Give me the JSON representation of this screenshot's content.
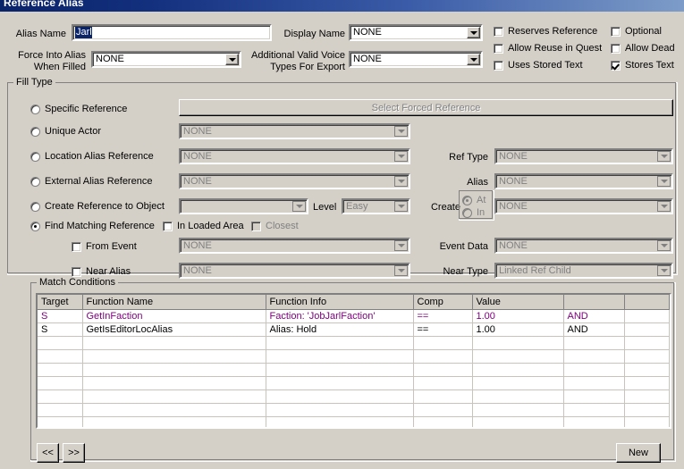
{
  "window": {
    "title": "Reference Alias"
  },
  "form": {
    "alias_name_label": "Alias Name",
    "alias_name_value": "Jarl",
    "display_name_label": "Display Name",
    "display_name_value": "NONE",
    "force_into_alias_label_l1": "Force Into Alias",
    "force_into_alias_label_l2": "When Filled",
    "force_into_alias_value": "NONE",
    "additional_voice_label_l1": "Additional Valid Voice",
    "additional_voice_label_l2": "Types For Export",
    "additional_voice_value": "NONE"
  },
  "flags": [
    {
      "label": "Reserves Reference",
      "checked": false
    },
    {
      "label": "Optional",
      "checked": false
    },
    {
      "label": "Allow Reuse in Quest",
      "checked": false
    },
    {
      "label": "Allow Dead",
      "checked": false
    },
    {
      "label": "Uses Stored Text",
      "checked": false
    },
    {
      "label": "Stores Text",
      "checked": true
    }
  ],
  "fill_type": {
    "group_label": "Fill Type",
    "options": [
      {
        "label": "Specific Reference",
        "selected": false
      },
      {
        "label": "Unique Actor",
        "selected": false
      },
      {
        "label": "Location Alias Reference",
        "selected": false
      },
      {
        "label": "External Alias Reference",
        "selected": false
      },
      {
        "label": "Create Reference to Object",
        "selected": false
      },
      {
        "label": "Find Matching Reference",
        "selected": true
      }
    ],
    "forced_reference_button": "Select Forced Reference",
    "unique_actor_value": "NONE",
    "location_alias_value": "NONE",
    "external_alias_value": "NONE",
    "create_ref_object_value": "",
    "level_label": "Level",
    "level_value": "Easy",
    "in_loaded_area_label": "In Loaded Area",
    "in_loaded_area_checked": false,
    "closest_label": "Closest",
    "closest_checked": false,
    "from_event_label": "From Event",
    "from_event_checked": false,
    "from_event_value": "NONE",
    "near_alias_label": "Near Alias",
    "near_alias_checked": false,
    "near_alias_value": "NONE",
    "ref_type_label": "Ref Type",
    "ref_type_value": "NONE",
    "alias_label": "Alias",
    "alias_value": "NONE",
    "create_label": "Create",
    "create_at_label": "At",
    "create_in_label": "In",
    "create_at_selected": true,
    "create_value": "NONE",
    "event_data_label": "Event Data",
    "event_data_value": "NONE",
    "near_type_label": "Near Type",
    "near_type_value": "Linked Ref Child"
  },
  "match_conditions": {
    "group_label": "Match Conditions",
    "columns": [
      "Target",
      "Function Name",
      "Function Info",
      "Comp",
      "Value",
      "",
      ""
    ],
    "rows": [
      {
        "cells": [
          "S",
          "GetInFaction",
          "Faction: 'JobJarlFaction'",
          "==",
          "1.00",
          "AND",
          ""
        ],
        "highlight": true
      },
      {
        "cells": [
          "S",
          "GetIsEditorLocAlias",
          "Alias: Hold",
          "==",
          "1.00",
          "AND",
          ""
        ],
        "highlight": false
      }
    ],
    "empty_row_count": 8
  },
  "footer": {
    "prev_label": "<<",
    "next_label": ">>",
    "new_label": "New"
  },
  "colors": {
    "face": "#d4d0c8",
    "highlight_row_text": "#800080",
    "title_left": "#0a246a",
    "title_right": "#7d9cc8",
    "selection": "#0a246a"
  }
}
